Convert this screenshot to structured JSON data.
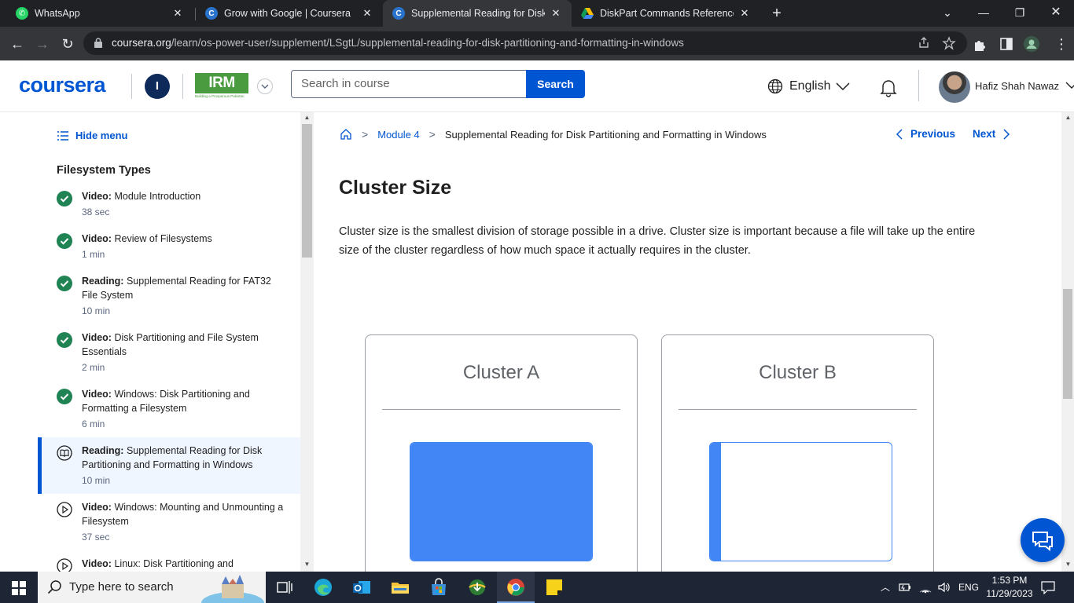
{
  "browser": {
    "tabs": [
      {
        "title": "WhatsApp",
        "favicon": "whatsapp-icon",
        "active": false
      },
      {
        "title": "Grow with Google | Coursera",
        "favicon": "coursera-icon",
        "active": false
      },
      {
        "title": "Supplemental Reading for Disk P",
        "favicon": "coursera-icon",
        "active": true
      },
      {
        "title": "DiskPart Commands Reference C",
        "favicon": "google-drive-icon",
        "active": false
      }
    ],
    "url_host": "coursera.org",
    "url_path": "/learn/os-power-user/supplement/LSgtL/supplemental-reading-for-disk-partitioning-and-formatting-in-windows"
  },
  "header": {
    "logo": "coursera",
    "org_initial": "I",
    "partner_logo": "IRM",
    "partner_tagline": "Building a Prosperous Pakistan",
    "search_placeholder": "Search in course",
    "search_button": "Search",
    "language": "English",
    "user_name": "Hafiz Shah Nawaz"
  },
  "sidebar": {
    "hide_menu": "Hide menu",
    "section_title": "Filesystem Types",
    "items": [
      {
        "type": "Video:",
        "title": "Module Introduction",
        "duration": "38 sec",
        "status": "completed"
      },
      {
        "type": "Video:",
        "title": "Review of Filesystems",
        "duration": "1 min",
        "status": "completed"
      },
      {
        "type": "Reading:",
        "title": "Supplemental Reading for FAT32 File System",
        "duration": "10 min",
        "status": "completed"
      },
      {
        "type": "Video:",
        "title": "Disk Partitioning and File System Essentials",
        "duration": "2 min",
        "status": "completed"
      },
      {
        "type": "Video:",
        "title": "Windows: Disk Partitioning and Formatting a Filesystem",
        "duration": "6 min",
        "status": "completed"
      },
      {
        "type": "Reading:",
        "title": "Supplemental Reading for Disk Partitioning and Formatting in Windows",
        "duration": "10 min",
        "status": "current"
      },
      {
        "type": "Video:",
        "title": "Windows: Mounting and Unmounting a Filesystem",
        "duration": "37 sec",
        "status": "not-started"
      },
      {
        "type": "Video:",
        "title": "Linux: Disk Partitioning and",
        "duration": "",
        "status": "not-started"
      }
    ]
  },
  "main": {
    "breadcrumb": {
      "module": "Module 4",
      "page": "Supplemental Reading for Disk Partitioning and Formatting in Windows"
    },
    "previous": "Previous",
    "next": "Next",
    "heading": "Cluster Size",
    "paragraph": "Cluster size is the smallest division of storage possible in a drive. Cluster size is important because a file will take up the entire size of the cluster regardless of how much space it actually requires in the cluster.",
    "figure": {
      "cluster_a": {
        "label": "Cluster A",
        "fill_fraction": 1.0
      },
      "cluster_b": {
        "label": "Cluster B",
        "fill_fraction": 0.06
      },
      "accent": "#4285f4"
    }
  },
  "taskbar": {
    "search_placeholder": "Type here to search",
    "language": "ENG",
    "time": "1:53 PM",
    "date": "11/29/2023"
  },
  "colors": {
    "brand": "#0056d2",
    "chrome_dark": "#202124",
    "chrome_toolbar": "#35363a",
    "taskbar": "#1e2535",
    "completed_green": "#1f8354"
  }
}
